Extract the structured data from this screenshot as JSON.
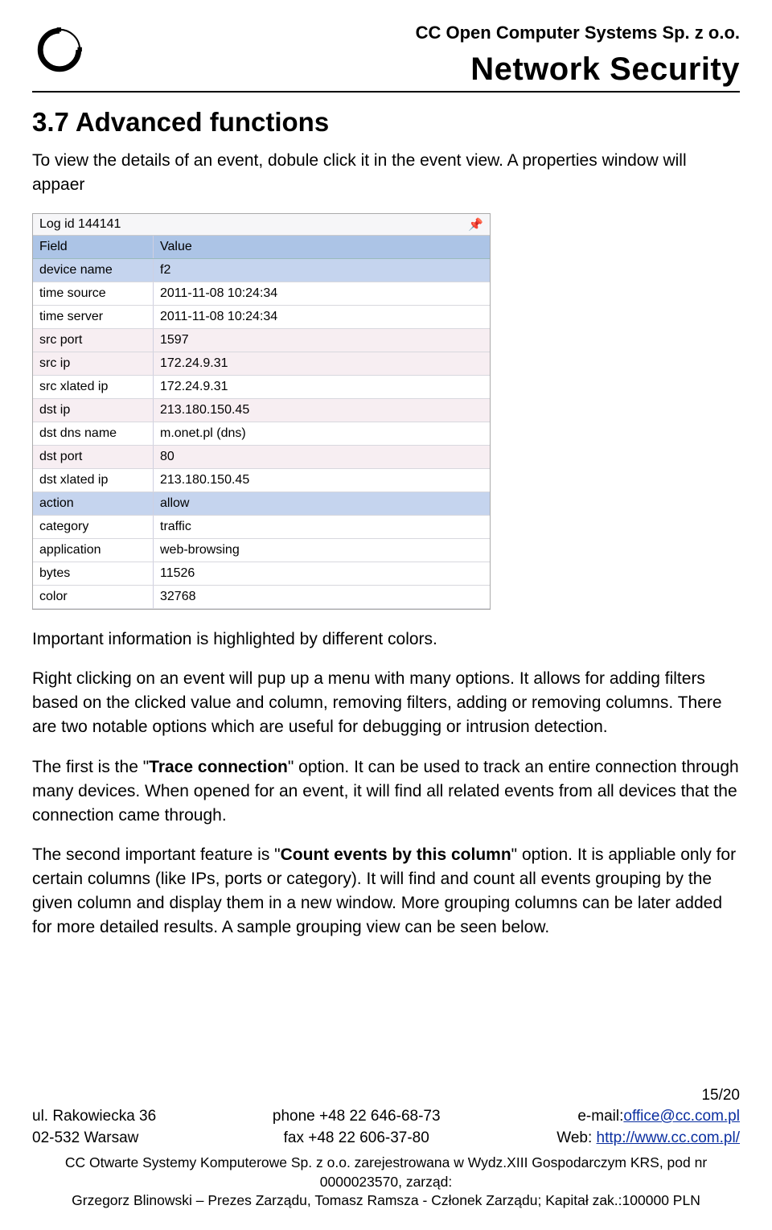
{
  "header": {
    "company": "CC Open Computer Systems Sp. z o.o.",
    "title": "Network Security"
  },
  "section": {
    "heading": "3.7 Advanced functions",
    "p1": "To view the details of an event, dobule click it in the event view. A properties window will appaer",
    "p2": "Important information is highlighted by different colors.",
    "p3": "Right clicking on an event will pup up a menu with many options. It allows for adding filters based on the clicked value and column, removing filters, adding or removing columns. There are two notable options which are useful for debugging or intrusion detection.",
    "p4a": "The first is the \"",
    "p4b": "Trace connection",
    "p4c": "\" option. It can be used to track an entire connection through many devices. When opened for an event, it will find all related events from all devices that the connection came through.",
    "p5a": "The second important feature is \"",
    "p5b": "Count events by this column",
    "p5c": "\" option. It is appliable only for certain columns (like IPs, ports or category). It will find and count all events grouping by the given column and display them in a new window. More grouping columns can be later added for more detailed results. A sample grouping view can be seen below."
  },
  "props": {
    "title": "Log id 144141",
    "header_field": "Field",
    "header_value": "Value",
    "rows": [
      {
        "field": "device name",
        "value": "f2",
        "hl": "blue"
      },
      {
        "field": "time source",
        "value": "2011-11-08 10:24:34",
        "hl": ""
      },
      {
        "field": "time server",
        "value": "2011-11-08 10:24:34",
        "hl": ""
      },
      {
        "field": "src port",
        "value": "1597",
        "hl": "pink"
      },
      {
        "field": "src ip",
        "value": "172.24.9.31",
        "hl": "pink"
      },
      {
        "field": "src xlated ip",
        "value": "172.24.9.31",
        "hl": ""
      },
      {
        "field": "dst ip",
        "value": "213.180.150.45",
        "hl": "pink"
      },
      {
        "field": "dst dns name",
        "value": "m.onet.pl (dns)",
        "hl": ""
      },
      {
        "field": "dst port",
        "value": "80",
        "hl": "pink"
      },
      {
        "field": "dst xlated ip",
        "value": "213.180.150.45",
        "hl": ""
      },
      {
        "field": "action",
        "value": "allow",
        "hl": "blue"
      },
      {
        "field": "category",
        "value": "traffic",
        "hl": ""
      },
      {
        "field": "application",
        "value": "web-browsing",
        "hl": ""
      },
      {
        "field": "bytes",
        "value": "11526",
        "hl": ""
      },
      {
        "field": "color",
        "value": "32768",
        "hl": ""
      }
    ]
  },
  "footer": {
    "page": "15/20",
    "addr1": "ul.  Rakowiecka 36",
    "addr2": "02-532 Warsaw",
    "phone": "phone +48 22 646-68-73",
    "fax": "fax +48 22 606-37-80",
    "email_label": "e-mail:",
    "email": "office@cc.com.pl",
    "web_label": "Web: ",
    "web": "http://www.cc.com.pl/",
    "legal1": "CC Otwarte Systemy Komputerowe Sp. z o.o. zarejestrowana w Wydz.XIII Gospodarczym KRS, pod nr 0000023570, zarząd:",
    "legal2": "Grzegorz Blinowski – Prezes Zarządu, Tomasz Ramsza - Członek Zarządu; Kapitał zak.:100000 PLN"
  }
}
